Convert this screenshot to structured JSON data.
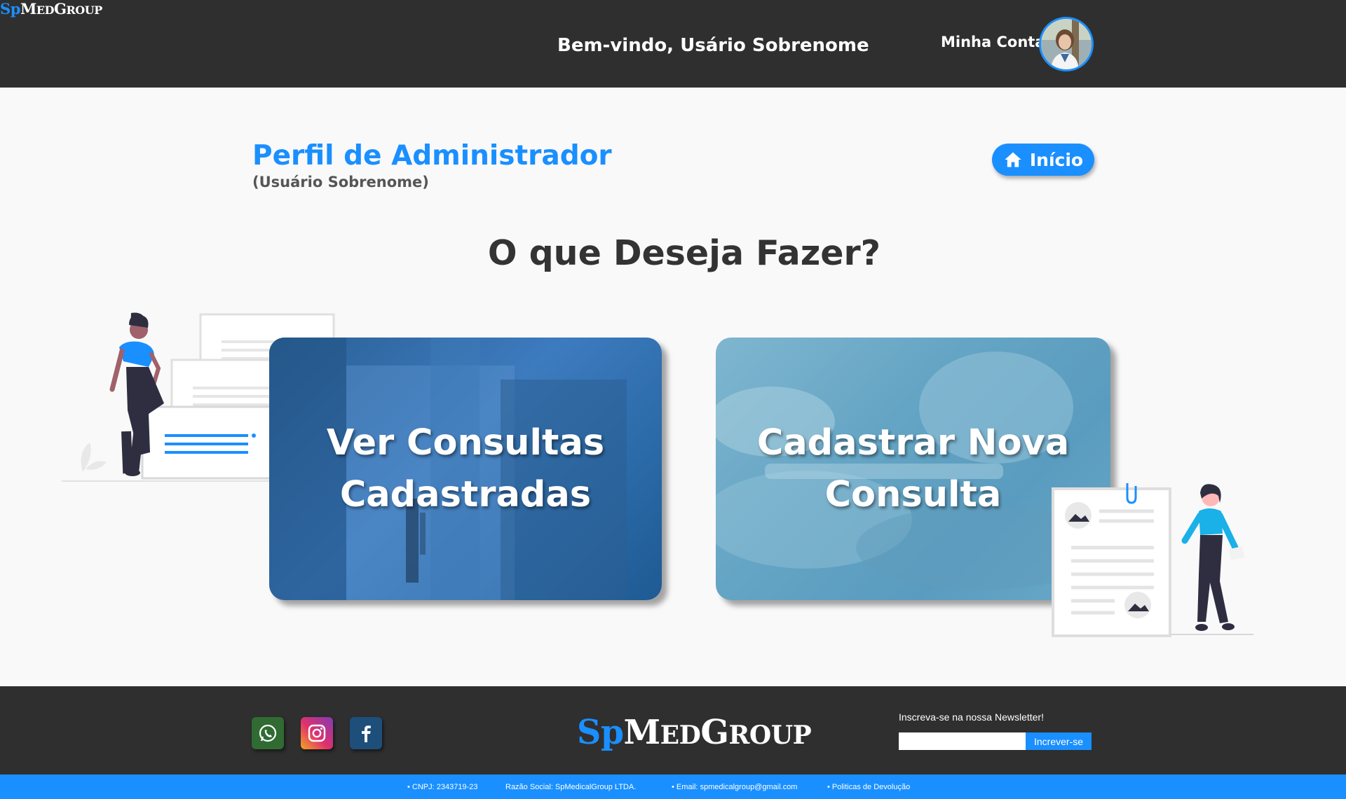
{
  "header": {
    "logo": {
      "sp": "Sp",
      "m": "M",
      "ed": "ED",
      "g": "G",
      "roup": "ROUP"
    },
    "welcome": "Bem-vindo, Usário Sobrenome",
    "account_label": "Minha Conta"
  },
  "profile": {
    "title": "Perfil de Administrador",
    "subtitle": "(Usuário Sobrenome)"
  },
  "home_button": {
    "label": "Início",
    "icon": "home-icon"
  },
  "question": "O que Deseja Fazer?",
  "cards": [
    {
      "label": "Ver Consultas\nCadastradas"
    },
    {
      "label": "Cadastrar Nova\nConsulta"
    }
  ],
  "footer": {
    "logo": {
      "sp": "Sp",
      "m": "M",
      "ed": "ED",
      "g": "G",
      "roup": "ROUP"
    },
    "social": [
      "whatsapp-icon",
      "instagram-icon",
      "facebook-icon"
    ],
    "newsletter_label": "Inscreva-se na nossa Newsletter!",
    "newsletter_value": "",
    "newsletter_button": "Increver-se"
  },
  "bottom_bar": {
    "cnpj": "• CNPJ: 2343719-23",
    "razao": "Razão Social: SpMedicalGroup LTDA.",
    "email": "• Email: spmedicalgroup@gmail.com",
    "politicas": "• Politicas de Devolução"
  },
  "colors": {
    "accent": "#1a8fff",
    "dark": "#2f2f2f",
    "background": "#f9f9f9"
  }
}
